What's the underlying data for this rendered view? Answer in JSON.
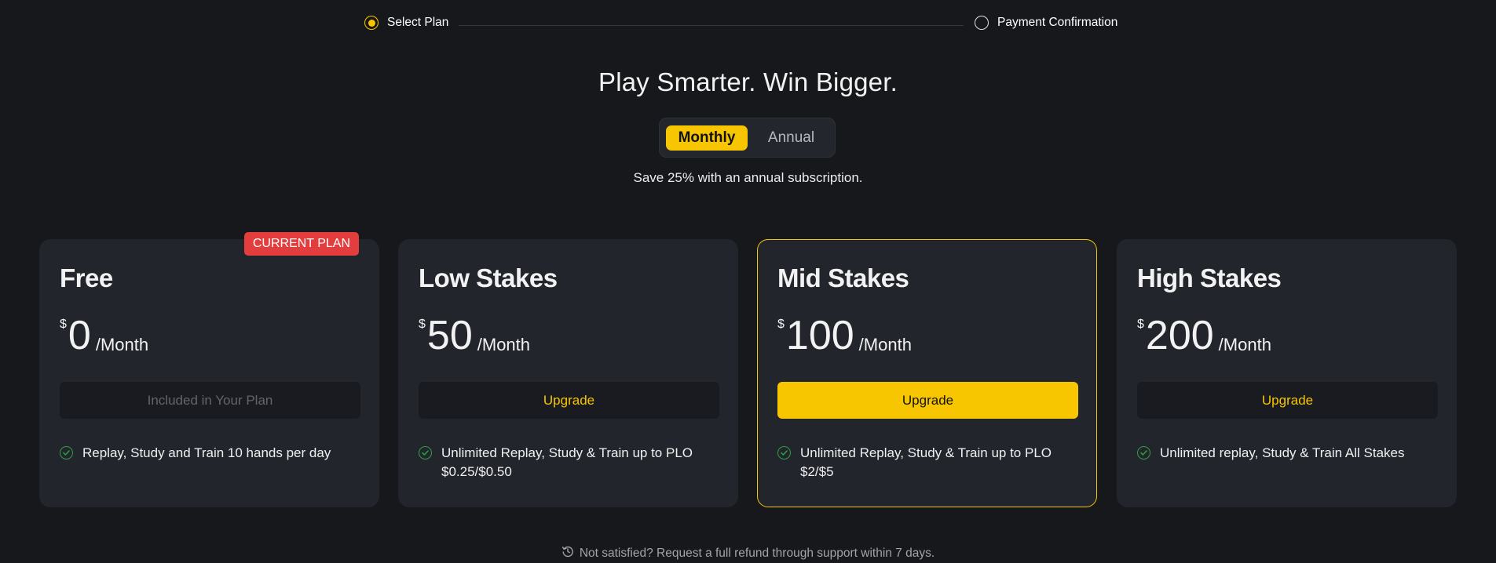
{
  "stepper": {
    "steps": [
      {
        "label": "Select Plan",
        "active": true
      },
      {
        "label": "Payment Confirmation",
        "active": false
      }
    ]
  },
  "headline": "Play Smarter. Win Bigger.",
  "billing": {
    "options": [
      "Monthly",
      "Annual"
    ],
    "selected": "Monthly",
    "note": "Save 25% with an annual subscription."
  },
  "plans": [
    {
      "name": "Free",
      "currency": "$",
      "price": "0",
      "period": "/Month",
      "badge": "CURRENT PLAN",
      "button": "Included in Your Plan",
      "feature": "Replay, Study and Train 10 hands per day"
    },
    {
      "name": "Low Stakes",
      "currency": "$",
      "price": "50",
      "period": "/Month",
      "button": "Upgrade",
      "feature": "Unlimited Replay, Study & Train up to PLO $0.25/$0.50"
    },
    {
      "name": "Mid Stakes",
      "currency": "$",
      "price": "100",
      "period": "/Month",
      "button": "Upgrade",
      "feature": "Unlimited Replay, Study & Train up to PLO $2/$5",
      "featured": true
    },
    {
      "name": "High Stakes",
      "currency": "$",
      "price": "200",
      "period": "/Month",
      "button": "Upgrade",
      "feature": "Unlimited replay, Study & Train All Stakes"
    }
  ],
  "refund_note": "Not satisfied? Request a full refund through support within 7 days.",
  "colors": {
    "background": "#17181c",
    "card": "#23252c",
    "accent": "#f7c600",
    "badge": "#e43d3d",
    "check": "#2ea043"
  },
  "icons": {
    "feature": "check-circle-icon",
    "refund": "history-icon"
  }
}
